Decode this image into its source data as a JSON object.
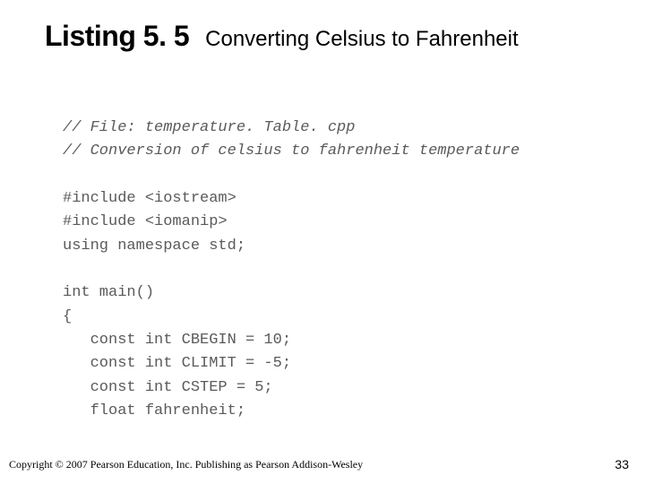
{
  "header": {
    "listing_label": "Listing 5. 5",
    "title": "Converting Celsius to Fahrenheit"
  },
  "code": {
    "c1": "// File: temperature. Table. cpp",
    "c2": "// Conversion of celsius to fahrenheit temperature",
    "l1": "#include <iostream>",
    "l2": "#include <iomanip>",
    "l3": "using namespace std;",
    "l4": "int main()",
    "l5": "{",
    "l6": "   const int CBEGIN = 10;",
    "l7": "   const int CLIMIT = -5;",
    "l8": "   const int CSTEP = 5;",
    "l9": "   float fahrenheit;"
  },
  "footer": {
    "copyright": "Copyright © 2007 Pearson Education, Inc. Publishing as Pearson Addison-Wesley",
    "page": "33"
  }
}
